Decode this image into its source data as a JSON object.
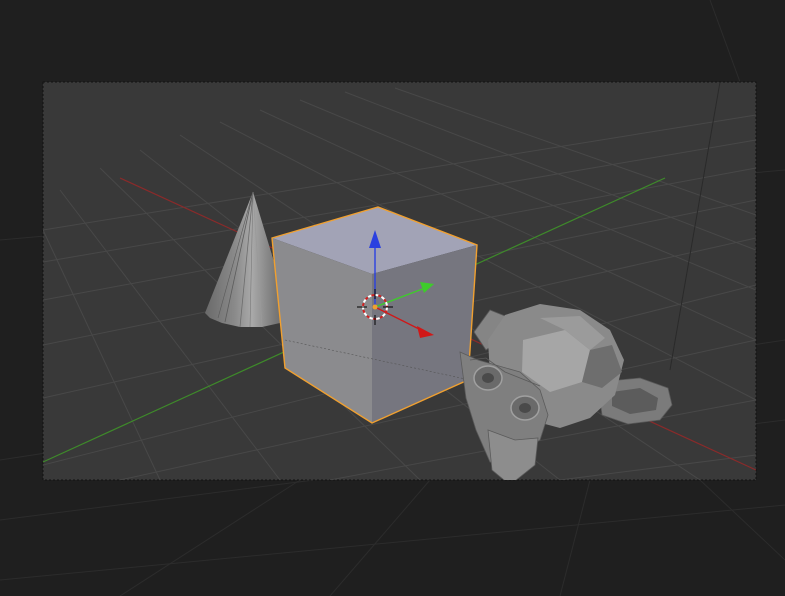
{
  "viewport": {
    "view": "camera-perspective",
    "background_color": "#1f1f1f",
    "camera_frame_color": "#393939",
    "grid_color": "#4a4a4a",
    "x_axis_color": "#8a2a2a",
    "y_axis_color": "#3e8a2a"
  },
  "scene_objects": [
    {
      "name": "cone",
      "selected": false
    },
    {
      "name": "cube",
      "selected": true
    },
    {
      "name": "suzanne",
      "selected": false
    }
  ],
  "gizmo": {
    "x_arrow_color": "#d01818",
    "y_arrow_color": "#3ecc2a",
    "z_arrow_color": "#2a40e0"
  },
  "selection_outline_color": "#f0a030",
  "cursor_3d": {
    "visible": true
  }
}
